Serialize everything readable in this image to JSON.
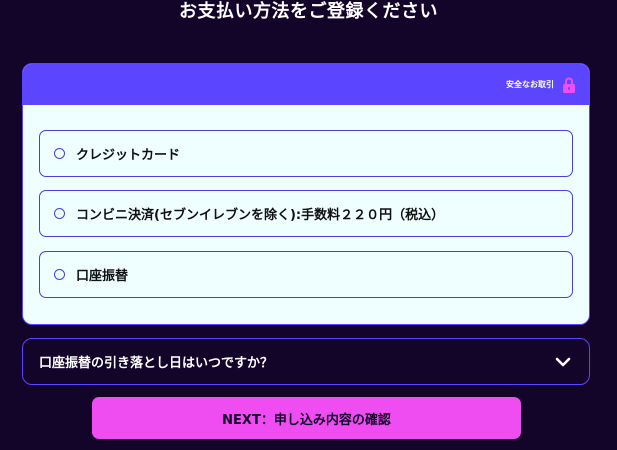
{
  "page_title": "お支払い方法をご登録ください",
  "payment_card": {
    "secure_label": "安全なお取引",
    "options": [
      {
        "label": "クレジットカード"
      },
      {
        "label": "コンビニ決済(セブンイレブンを除く):手数料２２０円（税込）"
      },
      {
        "label": "口座振替"
      }
    ]
  },
  "faq": {
    "question": "口座振替の引き落とし日はいつですか？"
  },
  "next_button": {
    "label": "NEXT：申し込み内容の確認"
  },
  "colors": {
    "background": "#13042a",
    "accent": "#5b45ff",
    "button": "#ef4cf1",
    "card": "#effefe",
    "lock": "#ef4cf1"
  },
  "icons": [
    "lock-icon",
    "radio-icon",
    "chevron-down-icon"
  ]
}
